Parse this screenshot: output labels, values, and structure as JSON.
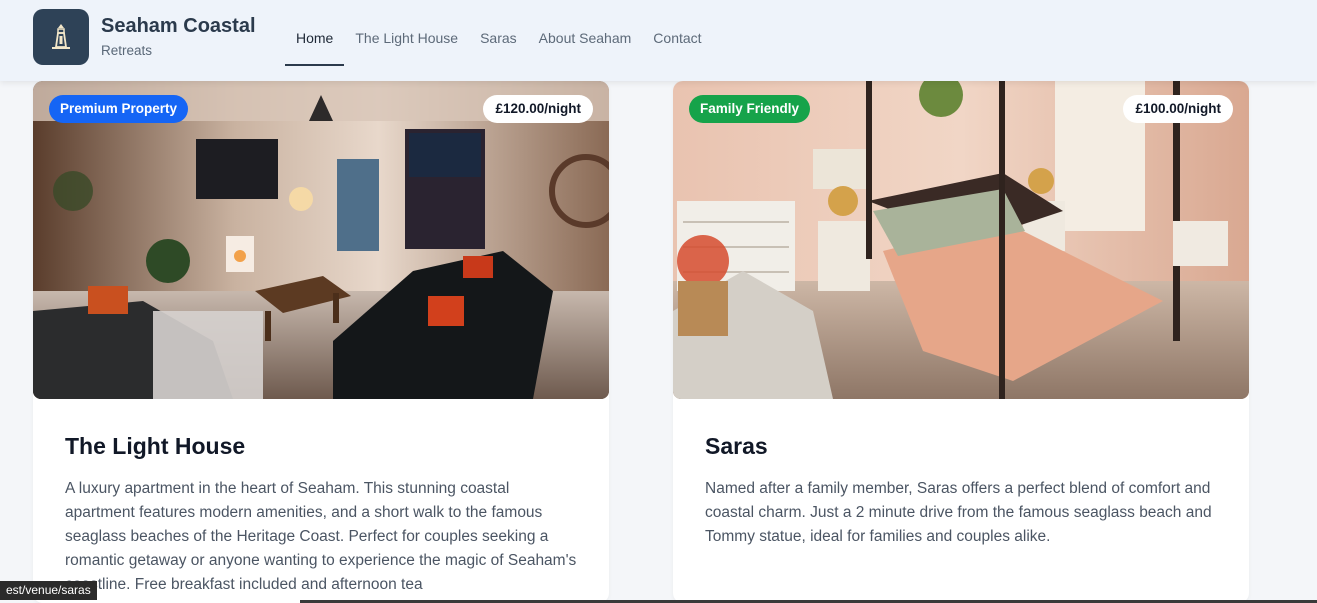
{
  "header": {
    "brand_title": "Seaham Coastal",
    "brand_subtitle": "Retreats",
    "logo_icon": "lighthouse-icon",
    "nav": [
      {
        "label": "Home",
        "active": true
      },
      {
        "label": "The Light House",
        "active": false
      },
      {
        "label": "Saras",
        "active": false
      },
      {
        "label": "About Seaham",
        "active": false
      },
      {
        "label": "Contact",
        "active": false
      }
    ]
  },
  "cards": [
    {
      "badge": "Premium Property",
      "badge_color": "#1565f5",
      "price": "£120.00/night",
      "title": "The Light House",
      "description": "A luxury apartment in the heart of Seaham. This stunning coastal apartment features modern amenities, and a short walk to the famous seaglass beaches of the Heritage Coast. Perfect for couples seeking a romantic getaway or anyone wanting to experience the magic of Seaham's coastline. Free breakfast included and afternoon tea"
    },
    {
      "badge": "Family Friendly",
      "badge_color": "#16a34a",
      "price": "£100.00/night",
      "title": "Saras",
      "description": "Named after a family member, Saras offers a perfect blend of comfort and coastal charm. Just a 2 minute drive from the famous seaglass beach and Tommy statue, ideal for families and couples alike."
    }
  ],
  "status_url": "est/venue/saras"
}
